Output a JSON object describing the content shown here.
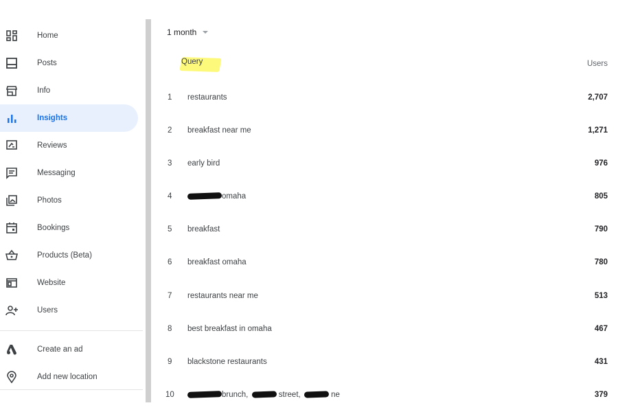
{
  "sidebar": {
    "items": [
      {
        "label": "Home",
        "icon": "dashboard-icon"
      },
      {
        "label": "Posts",
        "icon": "posts-icon"
      },
      {
        "label": "Info",
        "icon": "storefront-icon"
      },
      {
        "label": "Insights",
        "icon": "bar-chart-icon",
        "active": true
      },
      {
        "label": "Reviews",
        "icon": "reviews-icon"
      },
      {
        "label": "Messaging",
        "icon": "message-icon"
      },
      {
        "label": "Photos",
        "icon": "photos-icon"
      },
      {
        "label": "Bookings",
        "icon": "calendar-icon"
      },
      {
        "label": "Products (Beta)",
        "icon": "basket-icon"
      },
      {
        "label": "Website",
        "icon": "website-icon"
      },
      {
        "label": "Users",
        "icon": "add-user-icon"
      }
    ],
    "secondary": [
      {
        "label": "Create an ad",
        "icon": "google-ads-icon"
      },
      {
        "label": "Add new location",
        "icon": "location-pin-icon"
      }
    ]
  },
  "main": {
    "period": "1 month",
    "columns": {
      "query": "Query",
      "users": "Users"
    },
    "rows": [
      {
        "num": "1",
        "query": "restaurants",
        "users": "2,707"
      },
      {
        "num": "2",
        "query": "breakfast near me",
        "users": "1,271"
      },
      {
        "num": "3",
        "query": "early bird",
        "users": "976"
      },
      {
        "num": "4",
        "query": "omaha",
        "users": "805",
        "redacted_prefix": true
      },
      {
        "num": "5",
        "query": "breakfast",
        "users": "790"
      },
      {
        "num": "6",
        "query": "breakfast omaha",
        "users": "780"
      },
      {
        "num": "7",
        "query": "restaurants near me",
        "users": "513"
      },
      {
        "num": "8",
        "query": "best breakfast in omaha",
        "users": "467"
      },
      {
        "num": "9",
        "query": "blackstone restaurants",
        "users": "431"
      },
      {
        "num": "10",
        "query_parts": [
          "brunch,",
          "street,",
          "ne"
        ],
        "users": "379",
        "redacted_prefix": true
      }
    ]
  },
  "colors": {
    "accent": "#1a73e8",
    "active_bg": "#e8f0fe",
    "highlight": "#fdf97a"
  }
}
